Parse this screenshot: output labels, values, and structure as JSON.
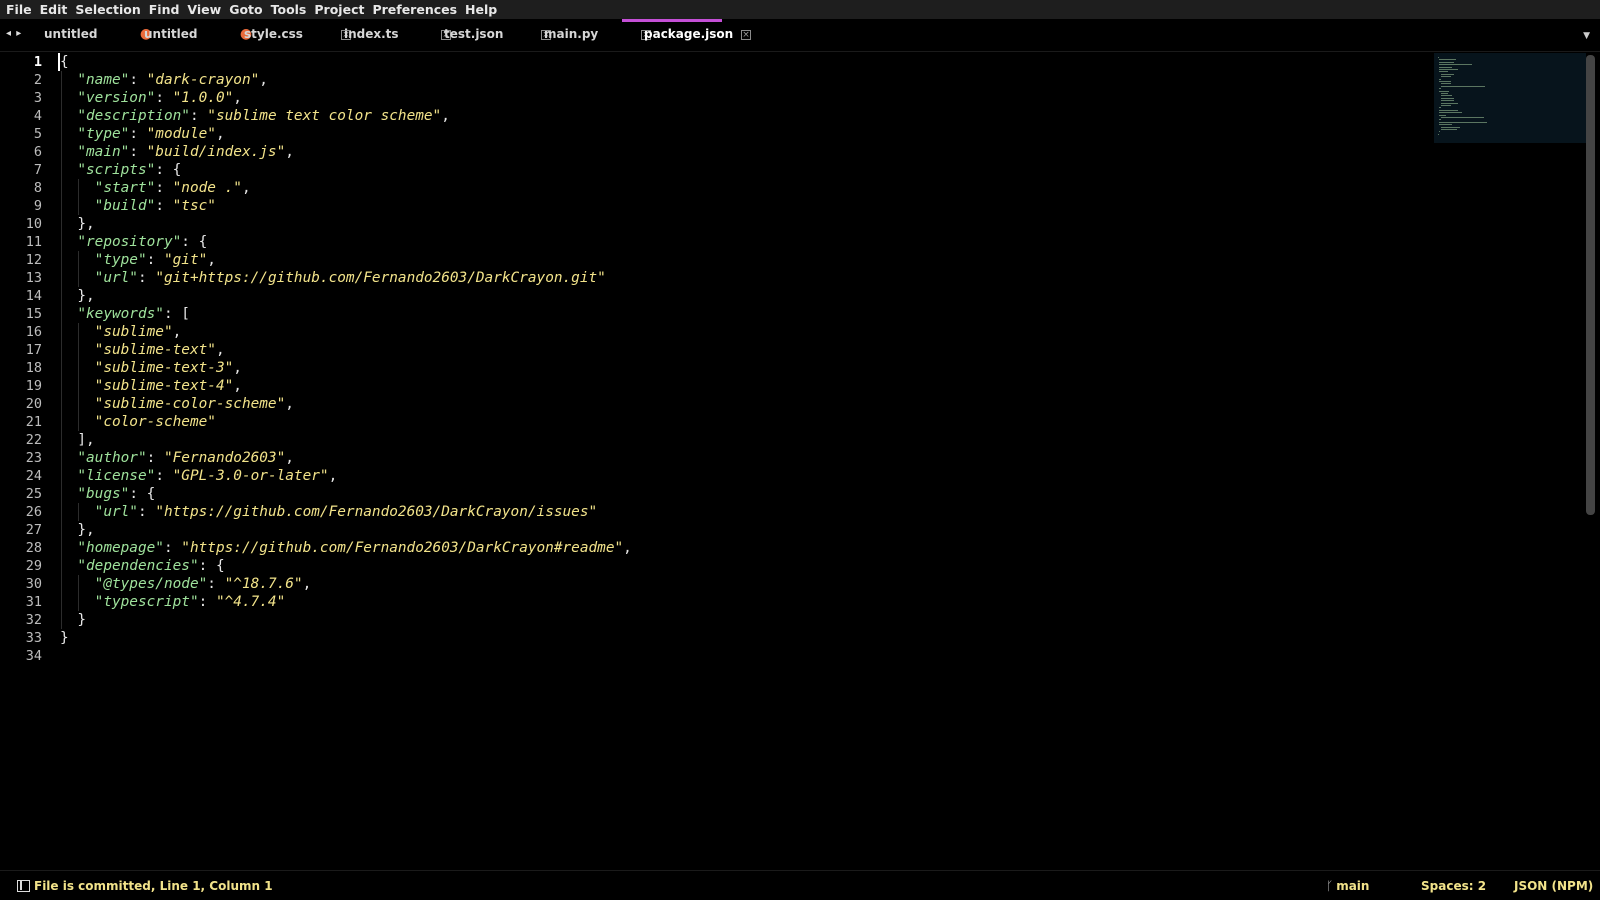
{
  "menu": [
    "File",
    "Edit",
    "Selection",
    "Find",
    "View",
    "Goto",
    "Tools",
    "Project",
    "Preferences",
    "Help"
  ],
  "tabs": [
    {
      "label": "untitled",
      "marker": "dot",
      "active": false
    },
    {
      "label": "untitled",
      "marker": "dot",
      "active": false
    },
    {
      "label": "style.css",
      "marker": "close",
      "active": false
    },
    {
      "label": "index.ts",
      "marker": "close",
      "active": false
    },
    {
      "label": "test.json",
      "marker": "close",
      "active": false
    },
    {
      "label": "main.py",
      "marker": "close",
      "active": false
    },
    {
      "label": "package.json",
      "marker": "close",
      "active": true
    }
  ],
  "nav_arrows": "◂ ▸",
  "tab_dropdown": "▼",
  "editor": {
    "current_line": 1,
    "lines": [
      [
        [
          "p",
          "{"
        ]
      ],
      [
        [
          "i",
          "  "
        ],
        [
          "k",
          "\"name\""
        ],
        [
          "p",
          ": "
        ],
        [
          "s",
          "\"dark-crayon\""
        ],
        [
          "p",
          ","
        ]
      ],
      [
        [
          "i",
          "  "
        ],
        [
          "k",
          "\"version\""
        ],
        [
          "p",
          ": "
        ],
        [
          "s",
          "\"1.0.0\""
        ],
        [
          "p",
          ","
        ]
      ],
      [
        [
          "i",
          "  "
        ],
        [
          "k",
          "\"description\""
        ],
        [
          "p",
          ": "
        ],
        [
          "s",
          "\"sublime text color scheme\""
        ],
        [
          "p",
          ","
        ]
      ],
      [
        [
          "i",
          "  "
        ],
        [
          "k",
          "\"type\""
        ],
        [
          "p",
          ": "
        ],
        [
          "s",
          "\"module\""
        ],
        [
          "p",
          ","
        ]
      ],
      [
        [
          "i",
          "  "
        ],
        [
          "k",
          "\"main\""
        ],
        [
          "p",
          ": "
        ],
        [
          "s",
          "\"build/index.js\""
        ],
        [
          "p",
          ","
        ]
      ],
      [
        [
          "i",
          "  "
        ],
        [
          "k",
          "\"scripts\""
        ],
        [
          "p",
          ": {"
        ]
      ],
      [
        [
          "i",
          "    "
        ],
        [
          "k",
          "\"start\""
        ],
        [
          "p",
          ": "
        ],
        [
          "s",
          "\"node .\""
        ],
        [
          "p",
          ","
        ]
      ],
      [
        [
          "i",
          "    "
        ],
        [
          "k",
          "\"build\""
        ],
        [
          "p",
          ": "
        ],
        [
          "s",
          "\"tsc\""
        ]
      ],
      [
        [
          "i",
          "  "
        ],
        [
          "p",
          "},"
        ]
      ],
      [
        [
          "i",
          "  "
        ],
        [
          "k",
          "\"repository\""
        ],
        [
          "p",
          ": {"
        ]
      ],
      [
        [
          "i",
          "    "
        ],
        [
          "k",
          "\"type\""
        ],
        [
          "p",
          ": "
        ],
        [
          "s",
          "\"git\""
        ],
        [
          "p",
          ","
        ]
      ],
      [
        [
          "i",
          "    "
        ],
        [
          "k",
          "\"url\""
        ],
        [
          "p",
          ": "
        ],
        [
          "s",
          "\"git+https://github.com/Fernando2603/DarkCrayon.git\""
        ]
      ],
      [
        [
          "i",
          "  "
        ],
        [
          "p",
          "},"
        ]
      ],
      [
        [
          "i",
          "  "
        ],
        [
          "k",
          "\"keywords\""
        ],
        [
          "p",
          ": ["
        ]
      ],
      [
        [
          "i",
          "    "
        ],
        [
          "s",
          "\"sublime\""
        ],
        [
          "p",
          ","
        ]
      ],
      [
        [
          "i",
          "    "
        ],
        [
          "s",
          "\"sublime-text\""
        ],
        [
          "p",
          ","
        ]
      ],
      [
        [
          "i",
          "    "
        ],
        [
          "s",
          "\"sublime-text-3\""
        ],
        [
          "p",
          ","
        ]
      ],
      [
        [
          "i",
          "    "
        ],
        [
          "s",
          "\"sublime-text-4\""
        ],
        [
          "p",
          ","
        ]
      ],
      [
        [
          "i",
          "    "
        ],
        [
          "s",
          "\"sublime-color-scheme\""
        ],
        [
          "p",
          ","
        ]
      ],
      [
        [
          "i",
          "    "
        ],
        [
          "s",
          "\"color-scheme\""
        ]
      ],
      [
        [
          "i",
          "  "
        ],
        [
          "p",
          "],"
        ]
      ],
      [
        [
          "i",
          "  "
        ],
        [
          "k",
          "\"author\""
        ],
        [
          "p",
          ": "
        ],
        [
          "s",
          "\"Fernando2603\""
        ],
        [
          "p",
          ","
        ]
      ],
      [
        [
          "i",
          "  "
        ],
        [
          "k",
          "\"license\""
        ],
        [
          "p",
          ": "
        ],
        [
          "s",
          "\"GPL-3.0-or-later\""
        ],
        [
          "p",
          ","
        ]
      ],
      [
        [
          "i",
          "  "
        ],
        [
          "k",
          "\"bugs\""
        ],
        [
          "p",
          ": {"
        ]
      ],
      [
        [
          "i",
          "    "
        ],
        [
          "k",
          "\"url\""
        ],
        [
          "p",
          ": "
        ],
        [
          "s",
          "\"https://github.com/Fernando2603/DarkCrayon/issues\""
        ]
      ],
      [
        [
          "i",
          "  "
        ],
        [
          "p",
          "},"
        ]
      ],
      [
        [
          "i",
          "  "
        ],
        [
          "k",
          "\"homepage\""
        ],
        [
          "p",
          ": "
        ],
        [
          "s",
          "\"https://github.com/Fernando2603/DarkCrayon#readme\""
        ],
        [
          "p",
          ","
        ]
      ],
      [
        [
          "i",
          "  "
        ],
        [
          "k",
          "\"dependencies\""
        ],
        [
          "p",
          ": {"
        ]
      ],
      [
        [
          "i",
          "    "
        ],
        [
          "k",
          "\"@types/node\""
        ],
        [
          "p",
          ": "
        ],
        [
          "s",
          "\"^18.7.6\""
        ],
        [
          "p",
          ","
        ]
      ],
      [
        [
          "i",
          "    "
        ],
        [
          "k",
          "\"typescript\""
        ],
        [
          "p",
          ": "
        ],
        [
          "s",
          "\"^4.7.4\""
        ]
      ],
      [
        [
          "i",
          "  "
        ],
        [
          "p",
          "}"
        ]
      ],
      [
        [
          "p",
          "}"
        ]
      ],
      []
    ]
  },
  "status": {
    "message": "File is committed, Line 1, Column 1",
    "git_branch": "main",
    "spaces": "Spaces: 2",
    "syntax": "JSON (NPM)"
  },
  "colors": {
    "key": "#9fe29c",
    "string": "#f2e38a",
    "accent_tab": "#c44fd6",
    "dirty_dot": "#e86a3a",
    "status_text": "#f2e38a"
  }
}
